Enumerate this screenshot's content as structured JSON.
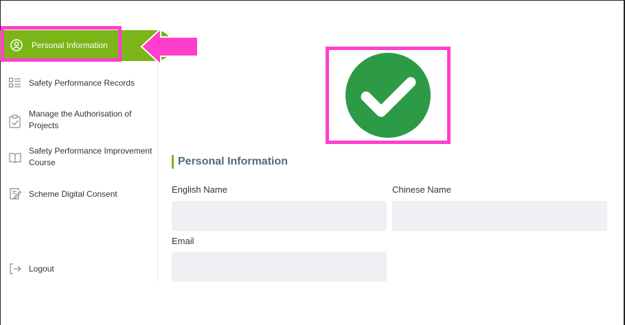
{
  "sidebar": {
    "active_item": {
      "label": "Personal Information",
      "icon": "user-circle-icon"
    },
    "items": [
      {
        "label": "Safety Performance Records",
        "icon": "list-icon"
      },
      {
        "label": "Manage the Authorisation of Projects",
        "label_line1": "Manage the Authorisation of",
        "label_line2": "Projects",
        "icon": "clipboard-check-icon"
      },
      {
        "label": "Safety Performance Improvement Course",
        "label_line1": "Safety Performance Improvement",
        "label_line2": "Course",
        "icon": "book-open-icon"
      },
      {
        "label": "Scheme Digital Consent",
        "icon": "document-edit-icon"
      }
    ],
    "logout": {
      "label": "Logout",
      "icon": "logout-icon"
    }
  },
  "main": {
    "status_icon": "check-circle-icon",
    "section_title": "Personal Information",
    "fields": {
      "english_name": {
        "label": "English Name",
        "value": ""
      },
      "chinese_name": {
        "label": "Chinese Name",
        "value": ""
      },
      "email": {
        "label": "Email",
        "value": ""
      }
    }
  },
  "colors": {
    "accent_green": "#7cb518",
    "check_green": "#2d9a46",
    "highlight_pink": "#ff3fcb",
    "input_bg": "#eef0f3",
    "title_color": "#4f6b7a"
  }
}
